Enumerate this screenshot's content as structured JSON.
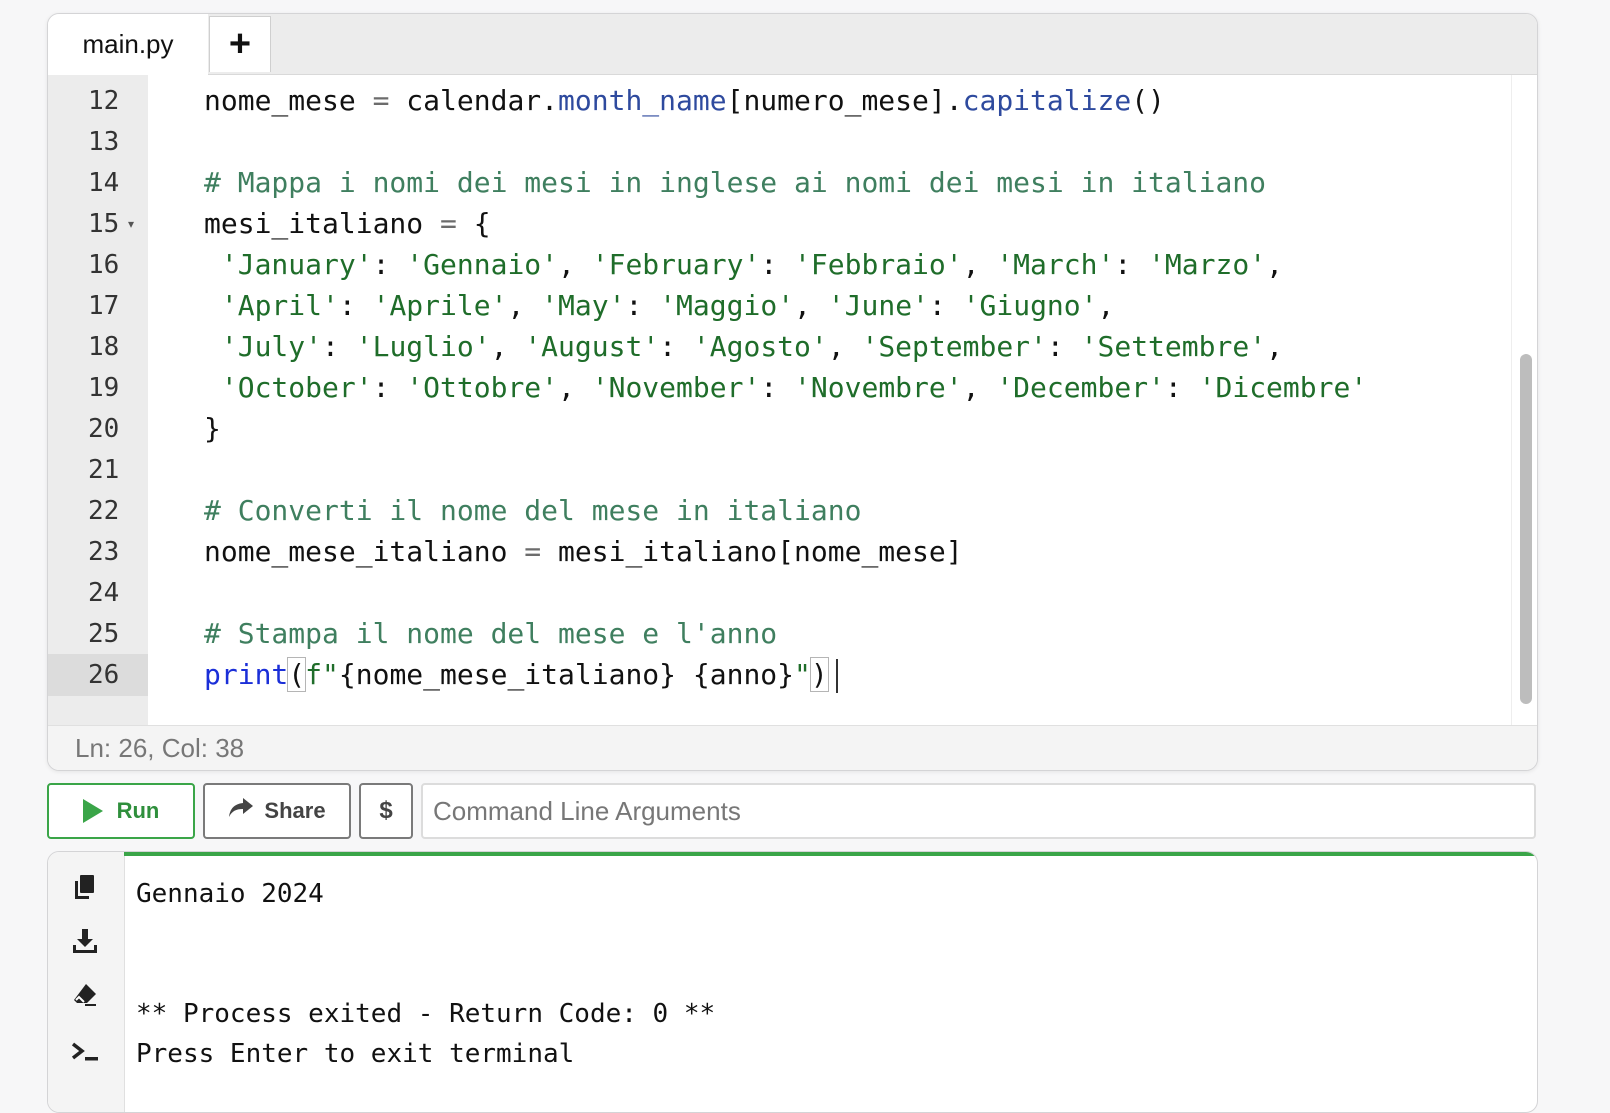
{
  "editor": {
    "tab_label": "main.py",
    "new_tab_label": "+",
    "lines": [
      {
        "n": "12"
      },
      {
        "n": "13"
      },
      {
        "n": "14"
      },
      {
        "n": "15"
      },
      {
        "n": "16"
      },
      {
        "n": "17"
      },
      {
        "n": "18"
      },
      {
        "n": "19"
      },
      {
        "n": "20"
      },
      {
        "n": "21"
      },
      {
        "n": "22"
      },
      {
        "n": "23"
      },
      {
        "n": "24"
      },
      {
        "n": "25"
      },
      {
        "n": "26"
      }
    ],
    "code": {
      "l12": {
        "a": "nome_mese",
        "eq": " = ",
        "b": "calendar.",
        "c": "month_name",
        "d": "[numero_mese].",
        "e": "capitalize",
        "f": "()"
      },
      "l14": "# Mappa i nomi dei mesi in inglese ai nomi dei mesi in italiano",
      "l15": {
        "a": "mesi_italiano",
        "eq": " = ",
        "b": "{"
      },
      "l16": {
        "s1": "'January'",
        "p1": ": ",
        "s2": "'Gennaio'",
        "p2": ", ",
        "s3": "'February'",
        "p3": ": ",
        "s4": "'Febbraio'",
        "p4": ", ",
        "s5": "'March'",
        "p5": ": ",
        "s6": "'Marzo'",
        "p6": ","
      },
      "l17": {
        "s1": "'April'",
        "p1": ": ",
        "s2": "'Aprile'",
        "p2": ", ",
        "s3": "'May'",
        "p3": ": ",
        "s4": "'Maggio'",
        "p4": ", ",
        "s5": "'June'",
        "p5": ": ",
        "s6": "'Giugno'",
        "p6": ","
      },
      "l18": {
        "s1": "'July'",
        "p1": ": ",
        "s2": "'Luglio'",
        "p2": ", ",
        "s3": "'August'",
        "p3": ": ",
        "s4": "'Agosto'",
        "p4": ", ",
        "s5": "'September'",
        "p5": ": ",
        "s6": "'Settembre'",
        "p6": ","
      },
      "l19": {
        "s1": "'October'",
        "p1": ": ",
        "s2": "'Ottobre'",
        "p2": ", ",
        "s3": "'November'",
        "p3": ": ",
        "s4": "'Novembre'",
        "p4": ", ",
        "s5": "'December'",
        "p5": ": ",
        "s6": "'Dicembre'"
      },
      "l20": "}",
      "l22": "# Converti il nome del mese in italiano",
      "l23": {
        "a": "nome_mese_italiano",
        "eq": " = ",
        "b": "mesi_italiano[nome_mese]"
      },
      "l25": "# Stampa il nome del mese e l'anno",
      "l26": {
        "kw": "print",
        "lp": "(",
        "fs": "f\"",
        "body": "{nome_mese_italiano} {anno}",
        "q": "\"",
        "rp": ")"
      }
    },
    "status": "Ln: 26,  Col: 38"
  },
  "actions": {
    "run_label": "Run",
    "share_label": "Share",
    "dollar_label": "$",
    "cmd_placeholder": "Command Line Arguments"
  },
  "terminal": {
    "output": "Gennaio 2024\n\n\n** Process exited - Return Code: 0 **\nPress Enter to exit terminal"
  },
  "colors": {
    "accent_green": "#3aa548",
    "comment": "#3f7f5f",
    "string": "#1f6d2a",
    "keyword": "#1b2fd8"
  }
}
